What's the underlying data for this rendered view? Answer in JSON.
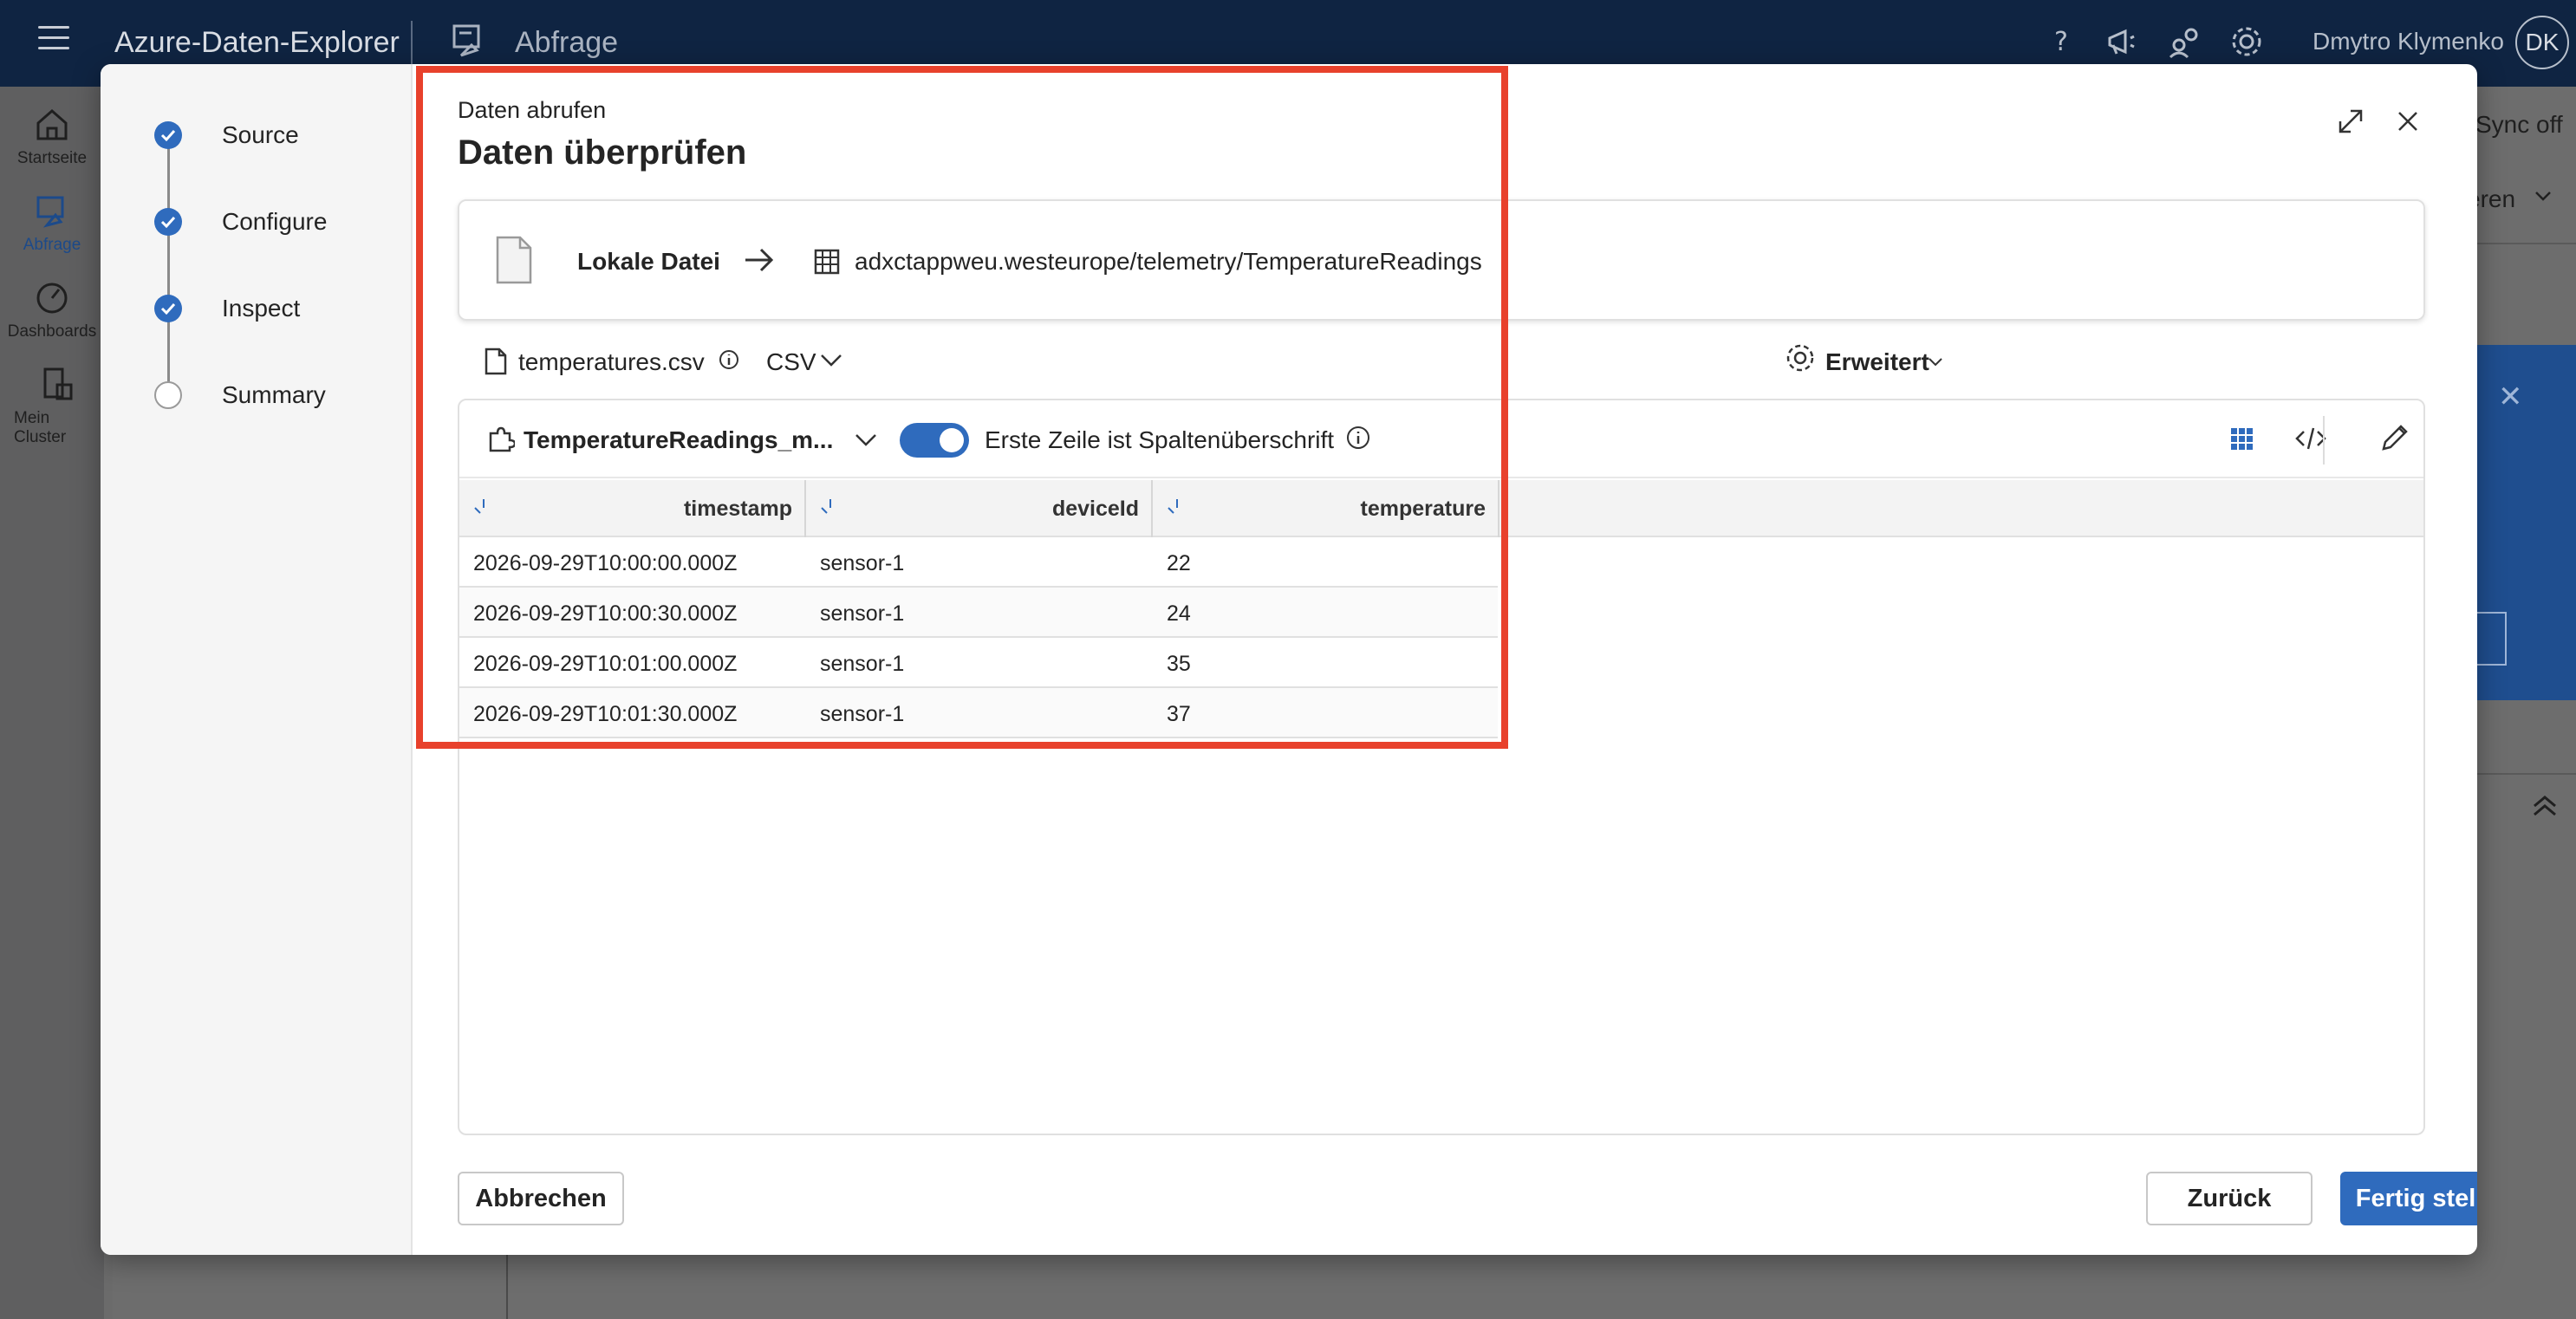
{
  "app": {
    "title": "Azure-Daten-Explorer",
    "section": "Abfrage",
    "user_name": "Dmytro Klymenko",
    "user_initials": "DK"
  },
  "nav": [
    {
      "label": "Startseite"
    },
    {
      "label": "Abfrage"
    },
    {
      "label": "Dashboards"
    },
    {
      "label_line1": "Mein",
      "label_line2": "Cluster"
    }
  ],
  "background": {
    "sync_text": "Sync off",
    "dropdown_fragment": "eren"
  },
  "wizard": {
    "steps": [
      {
        "label": "Source",
        "state": "done"
      },
      {
        "label": "Configure",
        "state": "done"
      },
      {
        "label": "Inspect",
        "state": "done"
      },
      {
        "label": "Summary",
        "state": "pending"
      }
    ],
    "breadcrumb": "Daten abrufen",
    "title": "Daten überprüfen",
    "source": {
      "name": "Lokale Datei",
      "destination": "adxctappweu.westeurope/telemetry/TemperatureReadings"
    },
    "file": {
      "name": "temperatures.csv",
      "format": "CSV",
      "advanced_label": "Erweitert"
    },
    "grid": {
      "mapping_name": "TemperatureReadings_m...",
      "header_toggle_label": "Erste Zeile ist Spaltenüberschrift",
      "header_toggle_on": true,
      "columns": [
        "timestamp",
        "deviceId",
        "temperature"
      ],
      "rows": [
        [
          "2026-09-29T10:00:00.000Z",
          "sensor-1",
          "22"
        ],
        [
          "2026-09-29T10:00:30.000Z",
          "sensor-1",
          "24"
        ],
        [
          "2026-09-29T10:01:00.000Z",
          "sensor-1",
          "35"
        ],
        [
          "2026-09-29T10:01:30.000Z",
          "sensor-1",
          "37"
        ]
      ]
    },
    "buttons": {
      "cancel": "Abbrechen",
      "back": "Zurück",
      "finish": "Fertig stellen"
    }
  },
  "colors": {
    "topbar": "#0f2442",
    "accent": "#2f6bbd",
    "highlight": "#e8412c"
  }
}
